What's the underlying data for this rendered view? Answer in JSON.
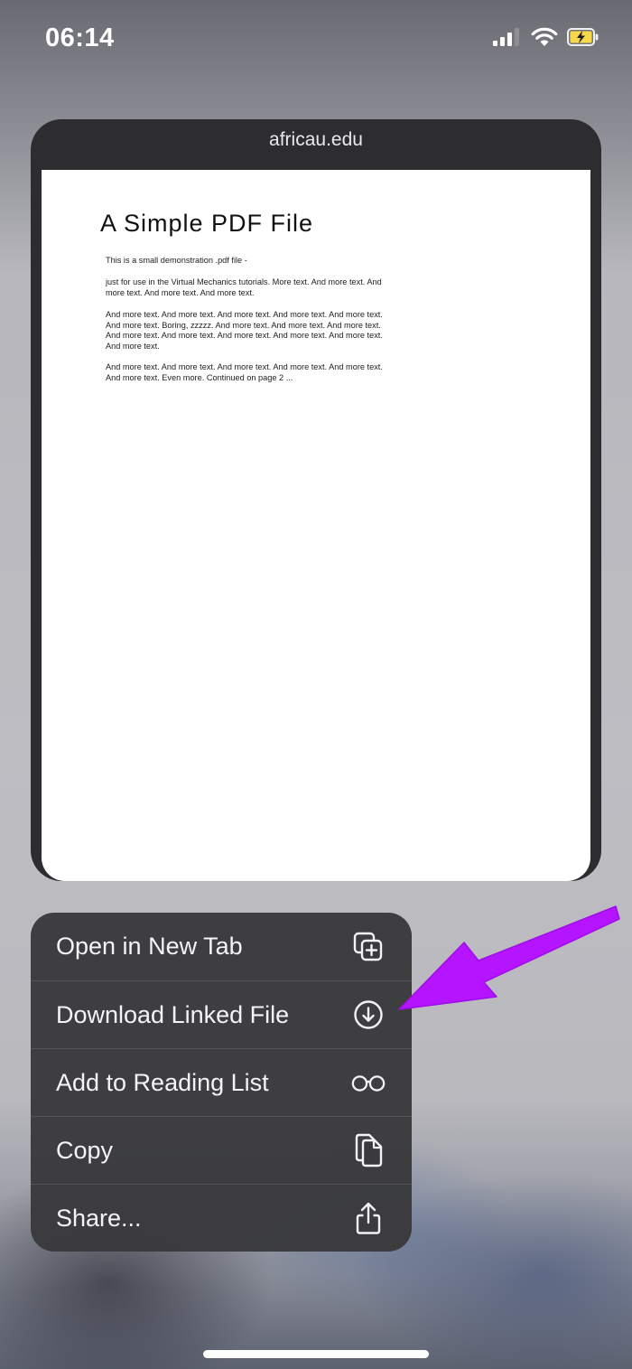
{
  "status_bar": {
    "time": "06:14",
    "icons": [
      "cellular-signal-icon",
      "wifi-icon",
      "battery-charging-icon"
    ]
  },
  "preview": {
    "url": "africau.edu",
    "pdf": {
      "title": "A Simple PDF File",
      "paragraphs": [
        "This is a small demonstration .pdf file -",
        "just for use in the Virtual Mechanics tutorials. More text. And more text. And more text. And more text. And more text.",
        "And more text. And more text. And more text. And more text. And more text. And more text. Boring, zzzzz. And more text. And more text. And more text. And more text. And more text. And more text. And more text. And more text. And more text.",
        "And more text. And more text. And more text. And more text. And more text. And more text. Even more. Continued on page 2 ..."
      ]
    }
  },
  "context_menu": {
    "items": [
      {
        "label": "Open in New Tab",
        "icon": "new-tab-icon"
      },
      {
        "label": "Download Linked File",
        "icon": "download-icon"
      },
      {
        "label": "Add to Reading List",
        "icon": "reading-list-glasses-icon"
      },
      {
        "label": "Copy",
        "icon": "copy-icon"
      },
      {
        "label": "Share...",
        "icon": "share-icon"
      }
    ]
  },
  "colors": {
    "menu_background": "#3a3a3c",
    "annotation_arrow": "#b414ff",
    "battery_fill": "#f6d94a"
  }
}
